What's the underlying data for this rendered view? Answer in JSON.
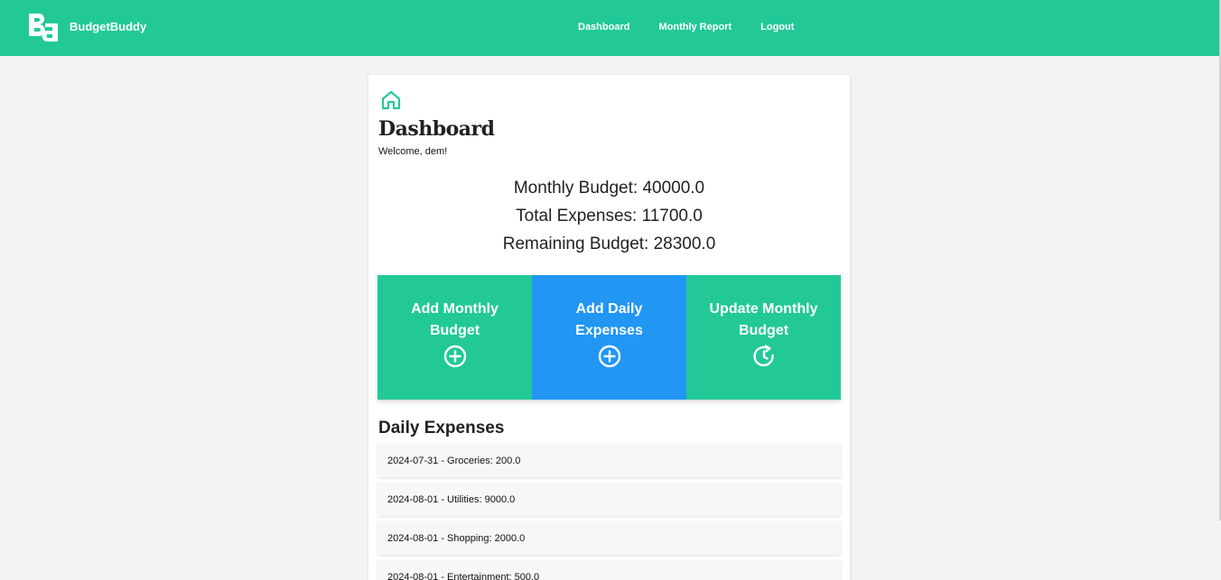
{
  "app": {
    "name": "BudgetBuddy",
    "logo_icon": "bb-logo-icon",
    "brand_color": "#22c997",
    "accent_blue": "#2196f3"
  },
  "nav": {
    "links": [
      "Dashboard",
      "Monthly Report",
      "Logout"
    ]
  },
  "dashboard": {
    "icon": "home-icon",
    "title": "Dashboard",
    "welcome": "Welcome, dem!",
    "monthly_budget": "Monthly Budget: 40000.0",
    "total_expenses": "Total Expenses: 11700.0",
    "remaining_budget": "Remaining Budget: 28300.0"
  },
  "actions": [
    {
      "label": "Add Monthly Budget",
      "icon": "plus-circle-icon",
      "color": "#22c997"
    },
    {
      "label": "Add Daily Expenses",
      "icon": "plus-circle-icon",
      "color": "#2196f3"
    },
    {
      "label": "Update Monthly Budget",
      "icon": "clock-refresh-icon",
      "color": "#22c997"
    }
  ],
  "expenses": {
    "title": "Daily Expenses",
    "items": [
      "2024-07-31 - Groceries: 200.0",
      "2024-08-01 - Utilities: 9000.0",
      "2024-08-01 - Shopping: 2000.0",
      "2024-08-01 - Entertainment: 500.0"
    ]
  }
}
